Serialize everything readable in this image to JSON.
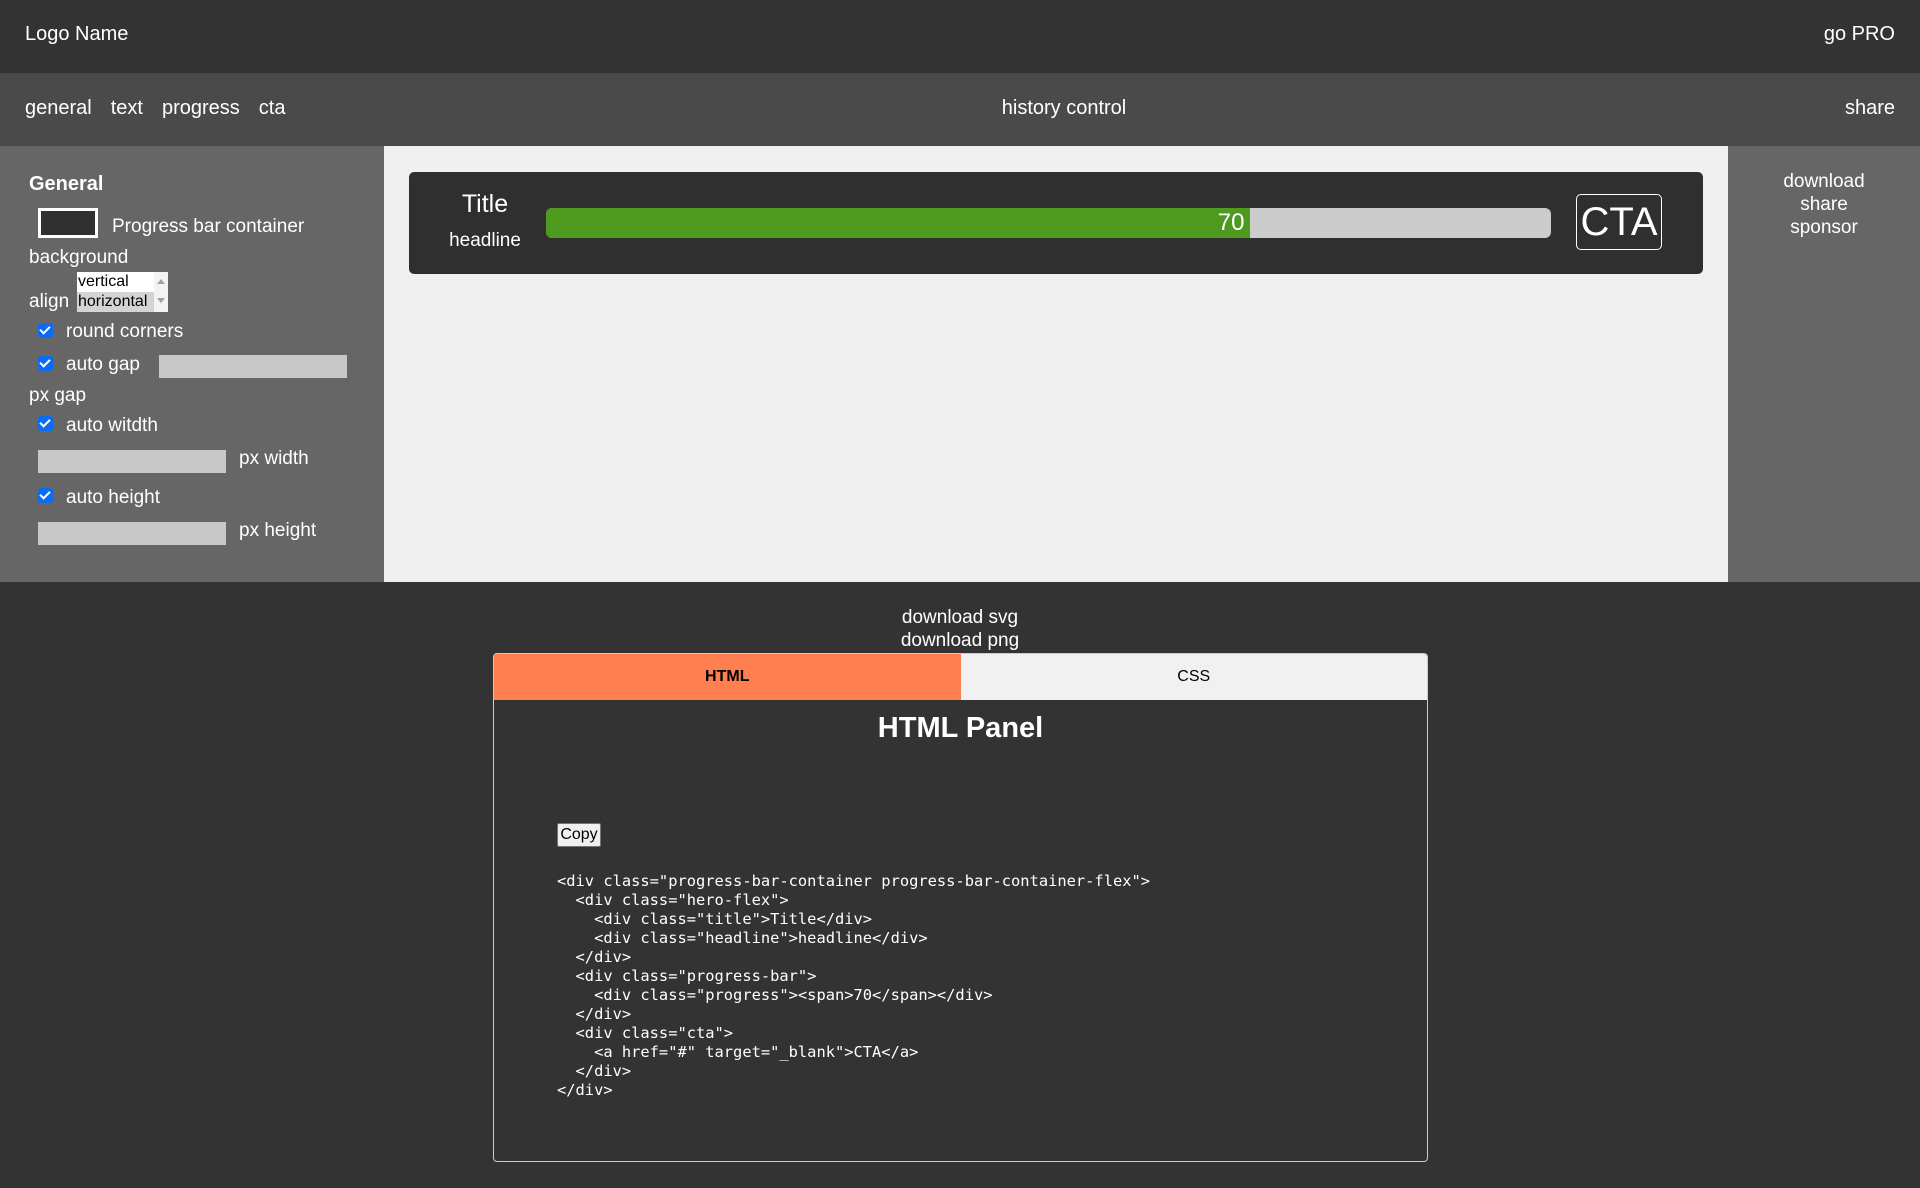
{
  "header": {
    "logo": "Logo Name",
    "go_pro": "go PRO"
  },
  "nav": {
    "tabs": [
      {
        "label": "general"
      },
      {
        "label": "text"
      },
      {
        "label": "progress"
      },
      {
        "label": "cta"
      }
    ],
    "history": "history control",
    "share": "share"
  },
  "sidebar": {
    "heading": "General",
    "swatch_color": "#2f2f2f",
    "container_label": "Progress bar container",
    "background_label": "background",
    "align_label": "align",
    "align_options": [
      "vertical",
      "horizontal"
    ],
    "align_selected": "horizontal",
    "round_corners": {
      "label": "round corners",
      "checked": true
    },
    "auto_gap": {
      "label": "auto gap",
      "checked": true
    },
    "px_gap": "px gap",
    "auto_width": {
      "label": "auto witdth",
      "checked": true
    },
    "px_width": "px width",
    "auto_height": {
      "label": "auto height",
      "checked": true
    },
    "px_height": "px height"
  },
  "preview": {
    "title": "Title",
    "headline": "headline",
    "progress_value": "70",
    "progress_percent": 70,
    "cta": "CTA",
    "colors": {
      "container": "#2f2f2f",
      "fill": "#4e9a1e",
      "track": "#cccccc"
    }
  },
  "right_panel": {
    "links": [
      "download",
      "share",
      "sponsor"
    ]
  },
  "export": {
    "download_svg": "download svg",
    "download_png": "download png"
  },
  "code_panel": {
    "tabs": [
      {
        "label": "HTML",
        "active": true
      },
      {
        "label": "CSS",
        "active": false
      }
    ],
    "title": "HTML Panel",
    "copy": "Copy",
    "code": "<div class=\"progress-bar-container progress-bar-container-flex\">\n  <div class=\"hero-flex\">\n    <div class=\"title\">Title</div>\n    <div class=\"headline\">headline</div>\n  </div>\n  <div class=\"progress-bar\">\n    <div class=\"progress\"><span>70</span></div>\n  </div>\n  <div class=\"cta\">\n    <a href=\"#\" target=\"_blank\">CTA</a>\n  </div>\n</div>",
    "accent_color": "#ff7f50"
  }
}
